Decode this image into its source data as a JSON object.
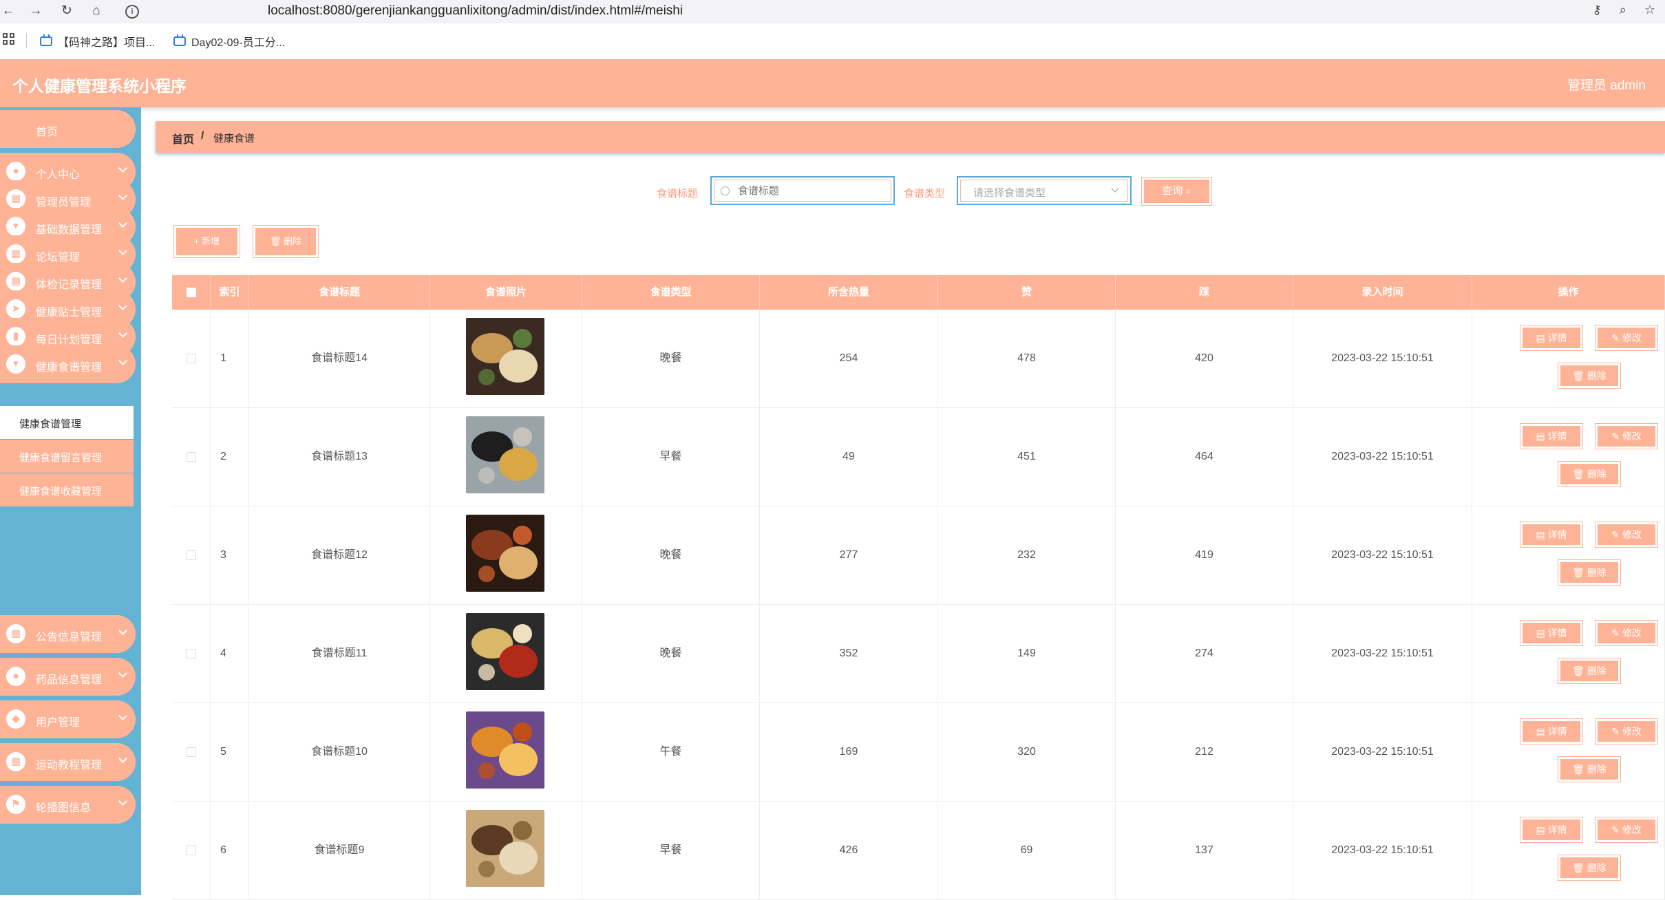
{
  "browser": {
    "url": "localhost:8080/gerenjiankangguanlixitong/admin/dist/index.html#/meishi",
    "bookmarks": [
      "【码神之路】项目...",
      "Day02-09-员工分..."
    ]
  },
  "header": {
    "title": "个人健康管理系统小程序",
    "user": "管理员 admin"
  },
  "sidebar": {
    "home": "首页",
    "menus": [
      {
        "label": "个人中心",
        "icon": "person-icon",
        "glyph": "●"
      },
      {
        "label": "管理员管理",
        "icon": "grid-icon",
        "glyph": "▦"
      },
      {
        "label": "基础数据管理",
        "icon": "monitor-icon",
        "glyph": "▾"
      },
      {
        "label": "论坛管理",
        "icon": "grid-icon",
        "glyph": "▦"
      },
      {
        "label": "体检记录管理",
        "icon": "grid-icon",
        "glyph": "▦"
      },
      {
        "label": "健康贴士管理",
        "icon": "send-icon",
        "glyph": "➤"
      },
      {
        "label": "每日计划管理",
        "icon": "chart-icon",
        "glyph": "▮"
      },
      {
        "label": "健康食谱管理",
        "icon": "monitor-icon",
        "glyph": "▾"
      }
    ],
    "submenus": [
      {
        "label": "健康食谱管理",
        "active": true
      },
      {
        "label": "健康食谱留言管理",
        "active": false
      },
      {
        "label": "健康食谱收藏管理",
        "active": false
      }
    ],
    "menus_after": [
      {
        "label": "公告信息管理",
        "icon": "grid-icon",
        "glyph": "▦"
      },
      {
        "label": "药品信息管理",
        "icon": "person-icon",
        "glyph": "●"
      },
      {
        "label": "用户管理",
        "icon": "pin-icon",
        "glyph": "◆"
      },
      {
        "label": "运动教程管理",
        "icon": "grid-icon",
        "glyph": "▦"
      },
      {
        "label": "轮播图信息",
        "icon": "flag-icon",
        "glyph": "⚑"
      }
    ]
  },
  "breadcrumb": {
    "home": "首页",
    "separator": "/",
    "current": "健康食谱"
  },
  "search": {
    "title_label": "食谱标题",
    "title_placeholder": "食谱标题",
    "type_label": "食谱类型",
    "type_placeholder": "请选择食谱类型",
    "query_button": "查询"
  },
  "actions": {
    "add": "+ 新增",
    "delete": "删除"
  },
  "table": {
    "columns": [
      "索引",
      "食谱标题",
      "食谱照片",
      "食谱类型",
      "所含热量",
      "赞",
      "踩",
      "录入时间",
      "操作"
    ],
    "ops": {
      "detail": "详情",
      "edit": "修改",
      "delete": "删除"
    },
    "rows": [
      {
        "index": "1",
        "title": "食谱标题14",
        "type": "晚餐",
        "calories": "254",
        "likes": "478",
        "dislikes": "420",
        "time": "2023-03-22 15:10:51",
        "img": [
          "#3b2a22",
          "#c89a55",
          "#e8d7b0",
          "#5a7a3a"
        ]
      },
      {
        "index": "2",
        "title": "食谱标题13",
        "type": "早餐",
        "calories": "49",
        "likes": "451",
        "dislikes": "464",
        "time": "2023-03-22 15:10:51",
        "img": [
          "#9aa3a8",
          "#1e1e1e",
          "#d9a845",
          "#c7c2bb"
        ]
      },
      {
        "index": "3",
        "title": "食谱标题12",
        "type": "晚餐",
        "calories": "277",
        "likes": "232",
        "dislikes": "419",
        "time": "2023-03-22 15:10:51",
        "img": [
          "#2a1a12",
          "#8a3a1e",
          "#e0b070",
          "#c45a2a"
        ]
      },
      {
        "index": "4",
        "title": "食谱标题11",
        "type": "晚餐",
        "calories": "352",
        "likes": "149",
        "dislikes": "274",
        "time": "2023-03-22 15:10:51",
        "img": [
          "#2b2b2b",
          "#d9b86a",
          "#b22a1a",
          "#f0e0c0"
        ]
      },
      {
        "index": "5",
        "title": "食谱标题10",
        "type": "午餐",
        "calories": "169",
        "likes": "320",
        "dislikes": "212",
        "time": "2023-03-22 15:10:51",
        "img": [
          "#6a4a8a",
          "#e08a2a",
          "#f5c060",
          "#c0501a"
        ]
      },
      {
        "index": "6",
        "title": "食谱标题9",
        "type": "早餐",
        "calories": "426",
        "likes": "69",
        "dislikes": "137",
        "time": "2023-03-22 15:10:51",
        "img": [
          "#c9a87a",
          "#5a3a22",
          "#e8d8b8",
          "#8a6a3a"
        ]
      }
    ]
  },
  "colors": {
    "accent": "#ffb396",
    "sidebar": "#64b3d4",
    "label": "#ff9a7a"
  }
}
